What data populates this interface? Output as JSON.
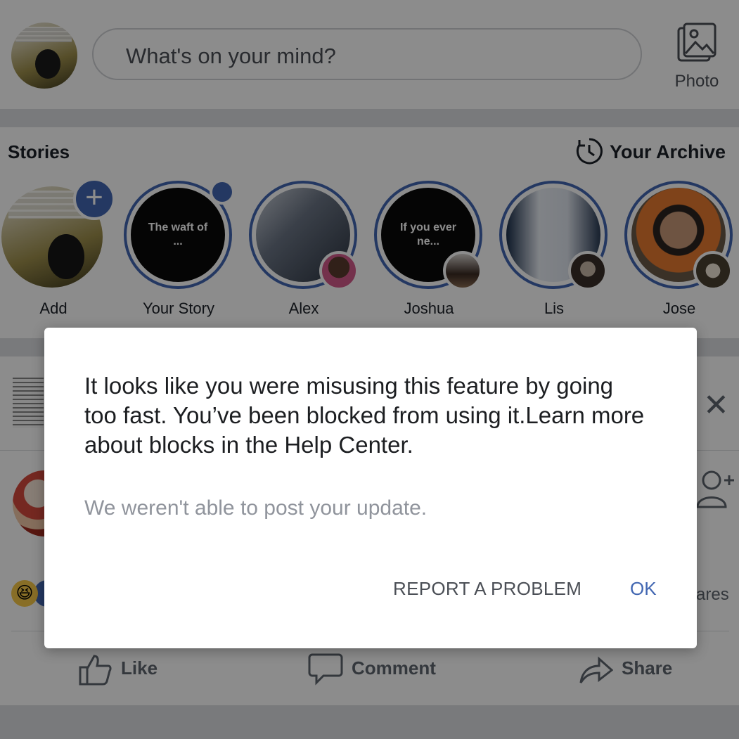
{
  "composer": {
    "placeholder": "What's on your mind?",
    "photo_label": "Photo"
  },
  "stories": {
    "title": "Stories",
    "archive_label": "Your Archive",
    "items": [
      {
        "name": "Add",
        "preview": ""
      },
      {
        "name": "Your Story",
        "preview": "The waft of ..."
      },
      {
        "name": "Alex",
        "preview": ""
      },
      {
        "name": "Joshua",
        "preview": "If you ever ne..."
      },
      {
        "name": "Lis",
        "preview": ""
      },
      {
        "name": "Jose",
        "preview": ""
      }
    ]
  },
  "post": {
    "shares_text": "ares",
    "actions": {
      "like": "Like",
      "comment": "Comment",
      "share": "Share"
    }
  },
  "dialog": {
    "message": "It looks like you were misusing this feature by going too fast. You’ve been blocked from using it.Learn more about blocks in the  Help Center.",
    "detail": "We weren't able to post your update.",
    "report_button": "REPORT A PROBLEM",
    "ok_button": "OK"
  },
  "colors": {
    "accent": "#4267b2",
    "text": "#1c1e21",
    "muted": "#90949c",
    "divider": "#dddfe2"
  },
  "icons": [
    "photo-icon",
    "archive-clock-icon",
    "plus-icon",
    "close-icon",
    "add-friend-icon",
    "haha-reaction-icon",
    "like-icon",
    "comment-icon",
    "share-icon"
  ]
}
